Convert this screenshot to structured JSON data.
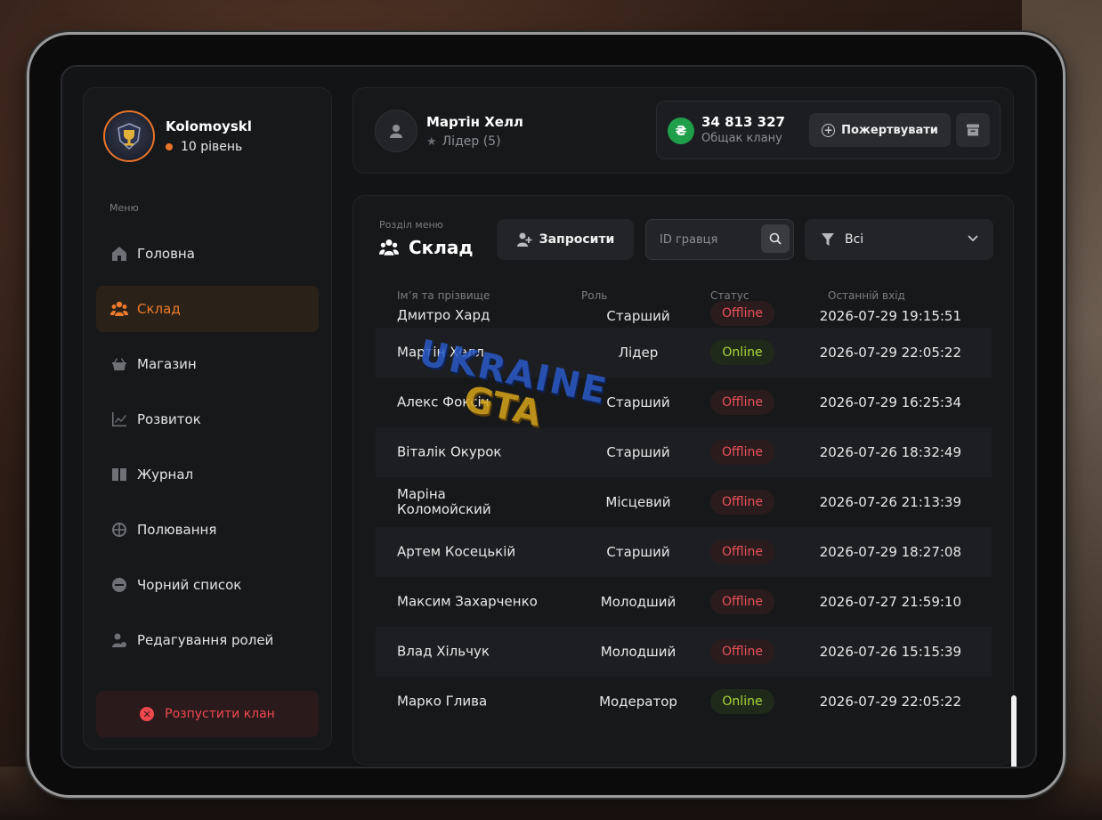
{
  "clan": {
    "name": "Kolomoyskl",
    "level": "10 рівень"
  },
  "menu": {
    "label": "Меню",
    "items": [
      {
        "label": "Головна",
        "icon": "home-icon"
      },
      {
        "label": "Склад",
        "icon": "members-icon",
        "active": true
      },
      {
        "label": "Магазин",
        "icon": "shop-basket-icon"
      },
      {
        "label": "Розвиток",
        "icon": "chart-icon"
      },
      {
        "label": "Журнал",
        "icon": "book-icon"
      },
      {
        "label": "Полювання",
        "icon": "crosshair-icon"
      },
      {
        "label": "Чорний список",
        "icon": "block-icon"
      },
      {
        "label": "Редагування ролей",
        "icon": "user-gear-icon"
      }
    ],
    "disband_label": "Розпустити клан"
  },
  "leader": {
    "name": "Мартін Хелл",
    "role": "Лідер (5)"
  },
  "funds": {
    "amount": "34 813 327",
    "label": "Общак клану",
    "currency_symbol": "₴",
    "donate_label": "Пожертвувати"
  },
  "section": {
    "caption": "Розділ меню",
    "title": "Склад",
    "invite_label": "Запросити",
    "search_placeholder": "ID гравця",
    "filter_value": "Всі"
  },
  "table": {
    "headers": {
      "name": "Ім’я та прізвище",
      "role": "Роль",
      "status": "Статус",
      "last": "Останній вхід"
    },
    "rows": [
      {
        "name": "Дмитро Хард",
        "role": "Старший",
        "status": "Offline",
        "last": "2026-07-29 19:15:51"
      },
      {
        "name": "Мартін Хелл",
        "role": "Лідер",
        "status": "Online",
        "last": "2026-07-29 22:05:22"
      },
      {
        "name": "Алекс Фоксіч",
        "role": "Старший",
        "status": "Offline",
        "last": "2026-07-29 16:25:34"
      },
      {
        "name": "Віталік Окурок",
        "role": "Старший",
        "status": "Offline",
        "last": "2026-07-26 18:32:49"
      },
      {
        "name": "Маріна Коломойский",
        "role": "Місцевий",
        "status": "Offline",
        "last": "2026-07-26 21:13:39"
      },
      {
        "name": "Артем Косецькій",
        "role": "Старший",
        "status": "Offline",
        "last": "2026-07-29 18:27:08"
      },
      {
        "name": "Максим Захарченко",
        "role": "Молодший",
        "status": "Offline",
        "last": "2026-07-27 21:59:10"
      },
      {
        "name": "Влад Хільчук",
        "role": "Молодший",
        "status": "Offline",
        "last": "2026-07-26 15:15:39"
      },
      {
        "name": "Марко Глива",
        "role": "Модератор",
        "status": "Online",
        "last": "2026-07-29 22:05:22"
      }
    ]
  },
  "watermark": {
    "line1": "UKRAINE",
    "line2": "GTA"
  },
  "colors": {
    "accent": "#ee7a2c",
    "online": "#a8d83a",
    "offline": "#e8505a",
    "danger": "#f0484f",
    "currency": "#1f9f4a"
  }
}
